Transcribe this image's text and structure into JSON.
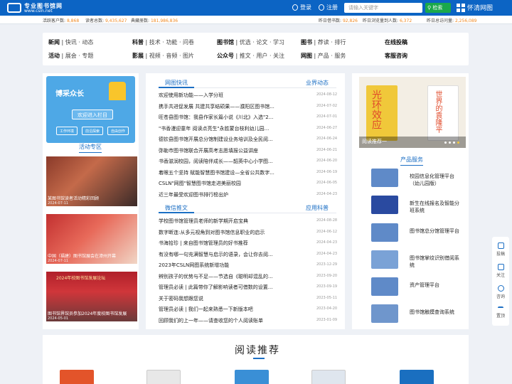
{
  "header": {
    "logo_cn": "专业图书馆网",
    "logo_en": "www.csln.net",
    "login": "登录",
    "register": "注册",
    "search_placeholder": "请输入关键字",
    "search_button": "检索",
    "lib_link": "怀清网图",
    "colors": {
      "primary": "#0c64c4",
      "search_green": "#1aa84b",
      "highlight": "#f08a24"
    }
  },
  "stats": [
    {
      "label": "活跃客户数:",
      "value": "8,868"
    },
    {
      "label": "读者总数:",
      "value": "9,435,627"
    },
    {
      "label": "典藏册数:",
      "value": "181,986,836"
    },
    {
      "label": "昨日借书数:",
      "value": "92,826"
    },
    {
      "label": "昨日浏览量到人数:",
      "value": "6,372"
    },
    {
      "label": "昨日总访问量:",
      "value": "2,256,089"
    }
  ],
  "nav": [
    {
      "title": "新闻",
      "subs": "快讯 · 动态"
    },
    {
      "title": "科普",
      "subs": "技术 · 功能 · 问卷"
    },
    {
      "title": "图书馆",
      "subs": "优选 · 论文 · 学习"
    },
    {
      "title": "图书",
      "subs": "荐读 · 排行"
    },
    {
      "title": "在线投稿",
      "subs": ""
    },
    {
      "title": "活动",
      "subs": "展会 · 专题"
    },
    {
      "title": "影展",
      "subs": "视频 · 音频 · 图片"
    },
    {
      "title": "公众号",
      "subs": "推文 · 用户 · 关注"
    },
    {
      "title": "网图",
      "subs": "产品 · 服务"
    },
    {
      "title": "客服咨询",
      "subs": ""
    }
  ],
  "left": {
    "banner_title": "博采众长",
    "banner_button": "欢迎进入栏目",
    "banner_tags": [
      "工作环境",
      "前沿探索",
      "自由创作"
    ],
    "activity_title": "活动专区",
    "photos": [
      {
        "caption": "某图书馆读者活动精彩回顾",
        "date": "2024-07-11"
      },
      {
        "caption": "中国（福建）图书馆展会在漳州开幕",
        "date": "2024-07-11"
      },
      {
        "caption": "2024年校图书馆发展论坛",
        "caption2": "图书馆界馆员参加2024年度校图书馆发展",
        "date": "2024-05-01"
      }
    ]
  },
  "news": {
    "tab1": "网图快讯",
    "tab1_right": "业界动态",
    "items1": [
      {
        "title": "欢迎使用新功能——入学分班",
        "date": "2024-08-12"
      },
      {
        "title": "携手共进促发展 共建共享结硕果——濮阳区图书馆...",
        "date": "2024-07-02"
      },
      {
        "title": "旺苍县图书馆：我县作家长篇小说《川北》入选\"2...",
        "date": "2024-07-01"
      },
      {
        "title": "\"书香漫迎童年 阅读点亮生\"永胜蒙台枝利幼儿园...",
        "date": "2024-06-27"
      },
      {
        "title": "德钦县图书馆开展总分馆制建设业务培训及全民阅...",
        "date": "2024-06-24"
      },
      {
        "title": "弥勒市图书馆联合开展高考志愿填报公益讲座",
        "date": "2024-06-21"
      },
      {
        "title": "书香滋润校园，阅读陪伴成长——韶英中心小学图...",
        "date": "2024-06-20"
      },
      {
        "title": "着眼五个坚持 赋能智慧图书馆建设—全省公共数字...",
        "date": "2024-06-19"
      },
      {
        "title": "CSLN\"网图\"智慧图书馆走进美丽校园",
        "date": "2024-06-05"
      },
      {
        "title": "近三年最受欢迎图书排行榜出炉",
        "date": "2024-04-23"
      }
    ],
    "tab2": "微信推文",
    "tab2_right": "应用科普",
    "items2": [
      {
        "title": "学校图书馆管理员老师的新学期开启宝典",
        "date": "2024-08-28"
      },
      {
        "title": "数字断连:从多元视角到对图书馆信息职业的启示",
        "date": "2024-06-12"
      },
      {
        "title": "书海拾珍 | 来自图书馆管理员的好书推荐",
        "date": "2024-04-23"
      },
      {
        "title": "有没有哪一句充满智慧与启示的语录，会让你去阅...",
        "date": "2024-04-23"
      },
      {
        "title": "2023年CSLN网图系统新增功能",
        "date": "2023-12-29"
      },
      {
        "title": "辨别孩子的优势与不足——节选自《聪明却混乱的...",
        "date": "2023-09-20"
      },
      {
        "title": "管理员必读 | 此篇带你了解影响读者可借数的设置...",
        "date": "2023-09-19"
      },
      {
        "title": "关于密码我想跟您说",
        "date": "2023-05-11"
      },
      {
        "title": "管理员必读 | 我们一起来熟悉一下新版本吧",
        "date": "2023-04-20"
      },
      {
        "title": "回顾我们的上一年——请查收您的个人阅读账单",
        "date": "2023-01-09"
      }
    ]
  },
  "right": {
    "hero_label": "阅读推荐一",
    "hero_books": [
      "光环效应",
      "世界的袁隆平"
    ],
    "service_title": "产品服务",
    "products": [
      "校园信息化管理平台（幼儿园版）",
      "新生在线报名及智能分班系统",
      "图书馆总分馆管理平台",
      "图书馆掌纹识别借阅系统",
      "资产管理平台",
      "图书馆触摸查询系统"
    ]
  },
  "sidetools": [
    "投稿",
    "关注",
    "咨询",
    "置顶"
  ],
  "recommend_title": "阅读推荐"
}
